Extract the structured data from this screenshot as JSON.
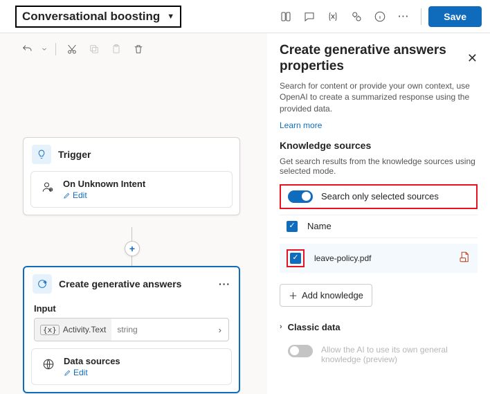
{
  "header": {
    "title": "Conversational boosting",
    "save": "Save"
  },
  "canvas": {
    "trigger": {
      "title": "Trigger",
      "event": "On Unknown Intent",
      "edit": "Edit"
    },
    "generative": {
      "title": "Create generative answers",
      "input_label": "Input",
      "input_var": "Activity.Text",
      "input_type": "string",
      "ds_title": "Data sources",
      "ds_edit": "Edit"
    }
  },
  "panel": {
    "title": "Create generative answers properties",
    "desc": "Search for content or provide your own context, use OpenAI to create a summarized response using the provided data.",
    "learn_more": "Learn more",
    "ks_title": "Knowledge sources",
    "ks_desc": "Get search results from the knowledge sources using selected mode.",
    "toggle_label": "Search only selected sources",
    "name_col": "Name",
    "source_file": "leave-policy.pdf",
    "add_knowledge": "Add knowledge",
    "classic": "Classic data",
    "ai_label": "Allow the AI to use its own general knowledge (preview)"
  }
}
